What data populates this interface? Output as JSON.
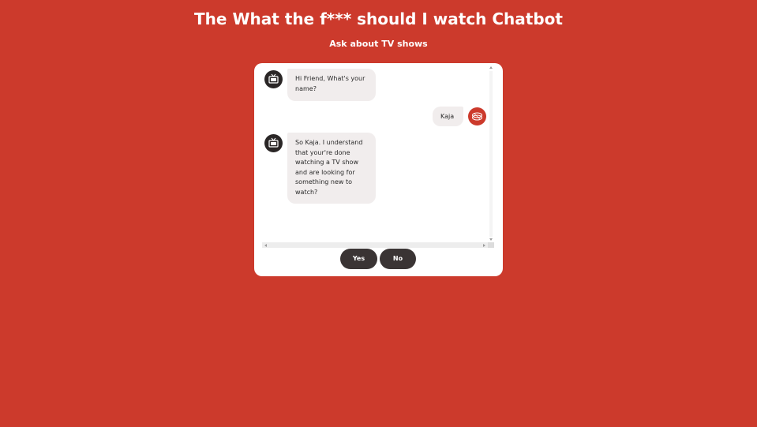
{
  "page": {
    "title": "The What the f*** should I watch Chatbot",
    "subtitle": "Ask about TV shows"
  },
  "chat": {
    "messages": [
      {
        "sender": "bot",
        "text": "Hi Friend, What's your name?"
      },
      {
        "sender": "user",
        "text": "Kaja"
      },
      {
        "sender": "bot",
        "text": "So Kaja. I understand that your're done watching a TV show and are looking for something new to watch?"
      }
    ],
    "options": [
      {
        "label": "Yes"
      },
      {
        "label": "No"
      }
    ]
  },
  "icons": {
    "bot_avatar": "tv-icon",
    "user_avatar": "user-avatar-icon"
  },
  "colors": {
    "background": "#cc3a2c",
    "chat_panel": "#ffffff",
    "bubble": "#f1eded",
    "button": "#3a3434",
    "bot_avatar": "#2a2626"
  }
}
